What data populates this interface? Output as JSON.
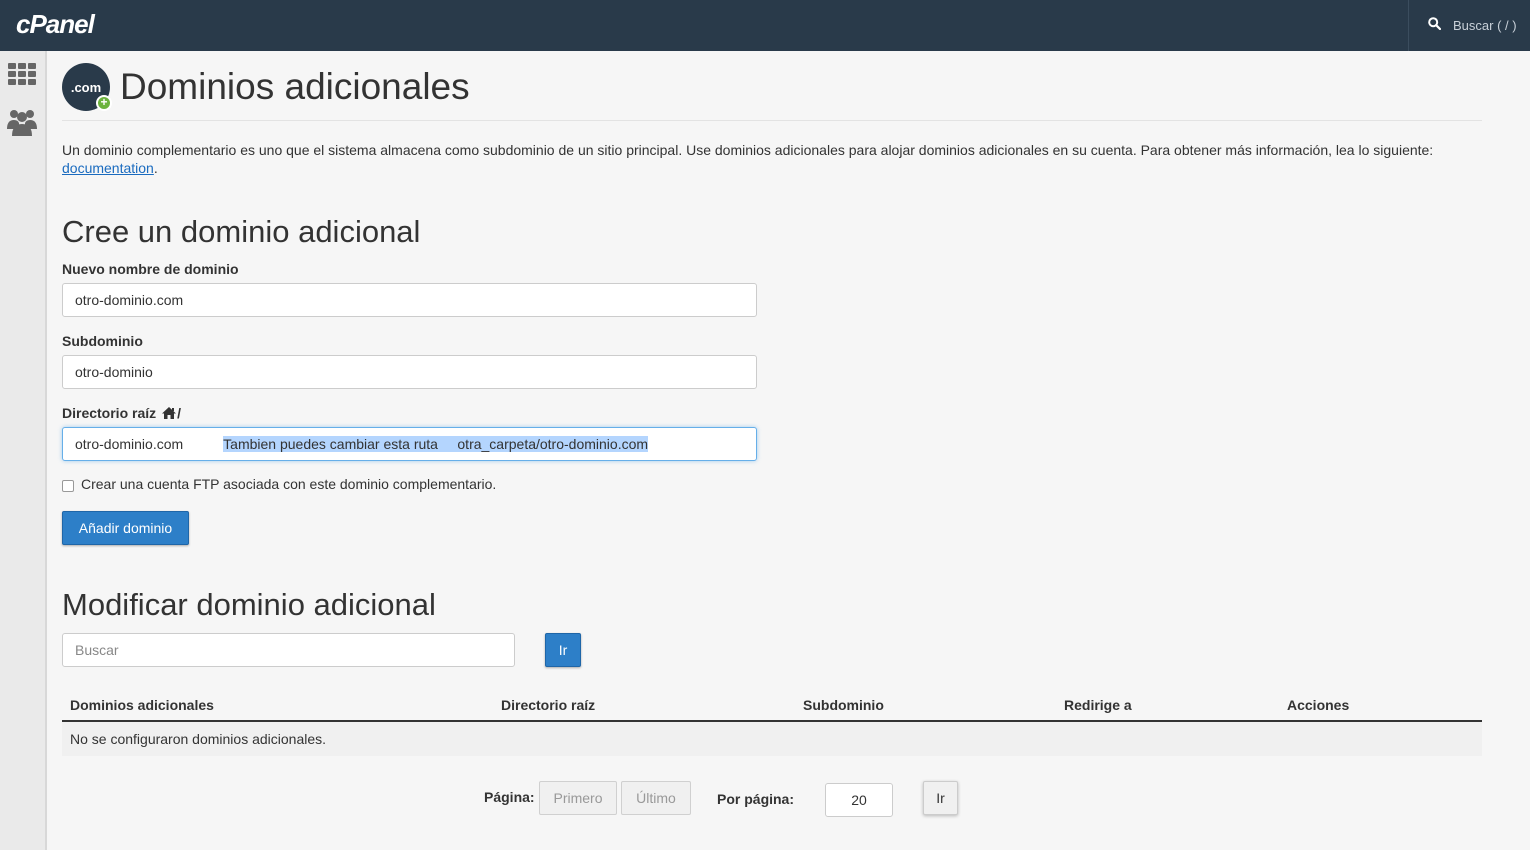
{
  "topbar": {
    "logo": "cPanel",
    "search_label": "Buscar ( / )"
  },
  "header": {
    "icon_text": ".com",
    "title": "Dominios adicionales"
  },
  "intro": {
    "text": "Un dominio complementario es uno que el sistema almacena como subdominio de un sitio principal. Use dominios adicionales para alojar dominios adicionales en su cuenta. Para obtener más información, lea lo siguiente: ",
    "link": "documentation",
    "end": "."
  },
  "create": {
    "heading": "Cree un dominio adicional",
    "domain_label": "Nuevo nombre de dominio",
    "domain_value": "otro-dominio.com",
    "subdomain_label": "Subdominio",
    "subdomain_value": "otro-dominio",
    "root_label": "Directorio raíz",
    "root_suffix": "/",
    "root_value": "otro-dominio.com",
    "root_highlight": "Tambien puedes cambiar esta ruta     otra_carpeta/otro-dominio.com",
    "ftp_label": "Crear una cuenta FTP asociada con este dominio complementario.",
    "add_button": "Añadir dominio"
  },
  "modify": {
    "heading": "Modificar dominio adicional",
    "search_placeholder": "Buscar",
    "go_button": "Ir",
    "columns": [
      "Dominios adicionales",
      "Directorio raíz",
      "Subdominio",
      "Redirige a",
      "Acciones"
    ],
    "empty_message": "No se configuraron dominios adicionales."
  },
  "pagination": {
    "page_label": "Página:",
    "first": "Primero",
    "last": "Último",
    "per_page_label": "Por página:",
    "per_page_value": "20",
    "go": "Ir"
  }
}
